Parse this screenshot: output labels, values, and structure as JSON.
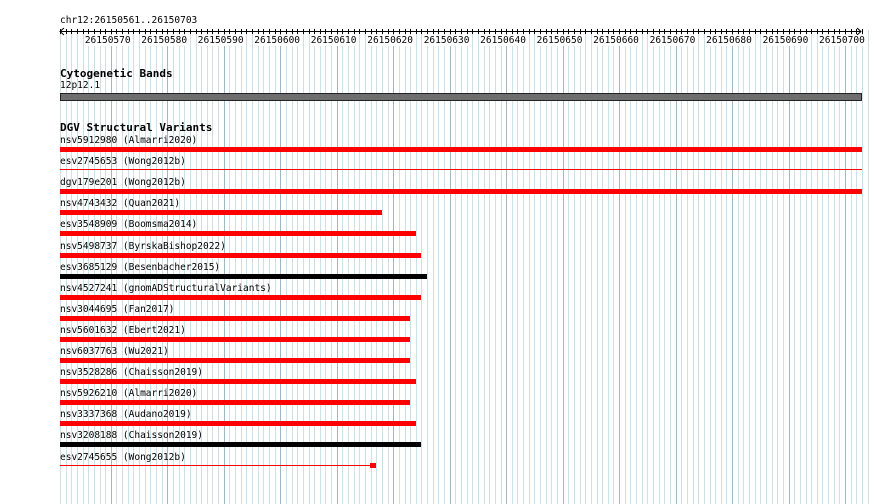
{
  "locus": "chr12:26150561..26150703",
  "view": {
    "start": 26150561,
    "end": 26150703
  },
  "ruler": {
    "ticks": [
      "26150570",
      "26150580",
      "26150590",
      "26150600",
      "26150610",
      "26150620",
      "26150630",
      "26150640",
      "26150650",
      "26150660",
      "26150670",
      "26150680",
      "26150690",
      "26150700"
    ]
  },
  "cytoband": {
    "title": "Cytogenetic Bands",
    "band": "12p12.1",
    "color": "#6e6e6e"
  },
  "dgv": {
    "title": "DGV Structural Variants",
    "colors": {
      "loss": "#ff0000",
      "gain_loss": "#000000"
    },
    "features": [
      {
        "label": "nsv5912980 (Almarri2020)",
        "start": 26150561,
        "end": 26150703,
        "color": "loss",
        "style": "bar"
      },
      {
        "label": "esv2745653 (Wong2012b)",
        "start": 26150561,
        "end": 26150703,
        "color": "loss",
        "style": "line"
      },
      {
        "label": "dgv179e201 (Wong2012b)",
        "start": 26150561,
        "end": 26150703,
        "color": "loss",
        "style": "bar"
      },
      {
        "label": "nsv4743432 (Quan2021)",
        "start": 26150561,
        "end": 26150618,
        "color": "loss",
        "style": "bar"
      },
      {
        "label": "esv3548909 (Boomsma2014)",
        "start": 26150561,
        "end": 26150624,
        "color": "loss",
        "style": "bar"
      },
      {
        "label": "nsv5498737 (ByrskaBishop2022)",
        "start": 26150561,
        "end": 26150625,
        "color": "loss",
        "style": "bar"
      },
      {
        "label": "esv3685129 (Besenbacher2015)",
        "start": 26150561,
        "end": 26150626,
        "color": "gain_loss",
        "style": "bar"
      },
      {
        "label": "nsv4527241 (gnomADStructuralVariants)",
        "start": 26150561,
        "end": 26150625,
        "color": "loss",
        "style": "bar"
      },
      {
        "label": "nsv3044695 (Fan2017)",
        "start": 26150561,
        "end": 26150623,
        "color": "loss",
        "style": "bar"
      },
      {
        "label": "nsv5601632 (Ebert2021)",
        "start": 26150561,
        "end": 26150623,
        "color": "loss",
        "style": "bar"
      },
      {
        "label": "nsv6037763 (Wu2021)",
        "start": 26150561,
        "end": 26150623,
        "color": "loss",
        "style": "bar"
      },
      {
        "label": "nsv3528286 (Chaisson2019)",
        "start": 26150561,
        "end": 26150624,
        "color": "loss",
        "style": "bar"
      },
      {
        "label": "nsv5926210 (Almarri2020)",
        "start": 26150561,
        "end": 26150623,
        "color": "loss",
        "style": "bar"
      },
      {
        "label": "nsv3337368 (Audano2019)",
        "start": 26150561,
        "end": 26150624,
        "color": "loss",
        "style": "bar"
      },
      {
        "label": "nsv3208188 (Chaisson2019)",
        "start": 26150561,
        "end": 26150625,
        "color": "gain_loss",
        "style": "bar"
      },
      {
        "label": "esv2745655 (Wong2012b)",
        "start": 26150561,
        "end": 26150617,
        "color": "loss",
        "style": "line-end"
      }
    ]
  }
}
